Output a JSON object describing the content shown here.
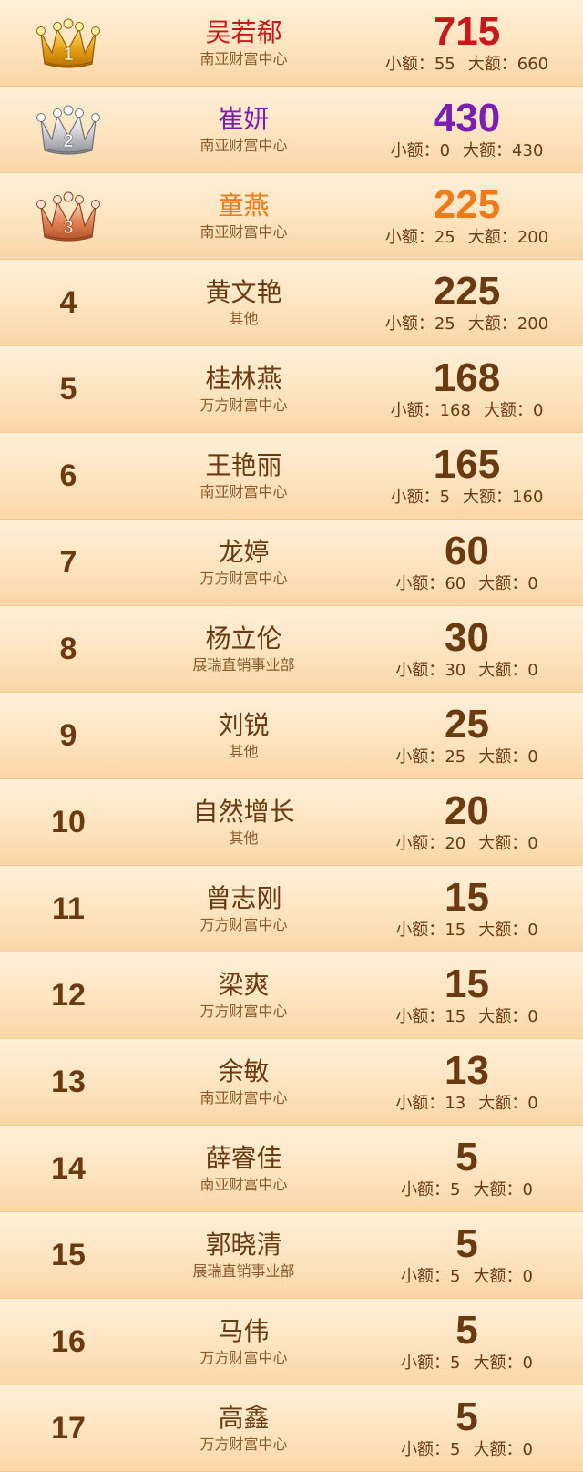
{
  "labels": {
    "small": "小额：",
    "big": "大额："
  },
  "colors": {
    "gold": "#c9181a",
    "silver": "#7a1fb0",
    "bronze": "#ef7a17",
    "default": "#6b3a10"
  },
  "rows": [
    {
      "rank": "1",
      "badge": "gold",
      "name": "吴若郗",
      "dept": "南亚财富中心",
      "total": "715",
      "small": "55",
      "big": "660"
    },
    {
      "rank": "2",
      "badge": "silver",
      "name": "崔妍",
      "dept": "南亚财富中心",
      "total": "430",
      "small": "0",
      "big": "430"
    },
    {
      "rank": "3",
      "badge": "bronze",
      "name": "童燕",
      "dept": "南亚财富中心",
      "total": "225",
      "small": "25",
      "big": "200"
    },
    {
      "rank": "4",
      "badge": "",
      "name": "黄文艳",
      "dept": "其他",
      "total": "225",
      "small": "25",
      "big": "200"
    },
    {
      "rank": "5",
      "badge": "",
      "name": "桂林燕",
      "dept": "万方财富中心",
      "total": "168",
      "small": "168",
      "big": "0"
    },
    {
      "rank": "6",
      "badge": "",
      "name": "王艳丽",
      "dept": "南亚财富中心",
      "total": "165",
      "small": "5",
      "big": "160"
    },
    {
      "rank": "7",
      "badge": "",
      "name": "龙婷",
      "dept": "万方财富中心",
      "total": "60",
      "small": "60",
      "big": "0"
    },
    {
      "rank": "8",
      "badge": "",
      "name": "杨立伦",
      "dept": "展瑞直销事业部",
      "total": "30",
      "small": "30",
      "big": "0"
    },
    {
      "rank": "9",
      "badge": "",
      "name": "刘锐",
      "dept": "其他",
      "total": "25",
      "small": "25",
      "big": "0"
    },
    {
      "rank": "10",
      "badge": "",
      "name": "自然增长",
      "dept": "其他",
      "total": "20",
      "small": "20",
      "big": "0"
    },
    {
      "rank": "11",
      "badge": "",
      "name": "曾志刚",
      "dept": "万方财富中心",
      "total": "15",
      "small": "15",
      "big": "0"
    },
    {
      "rank": "12",
      "badge": "",
      "name": "梁爽",
      "dept": "万方财富中心",
      "total": "15",
      "small": "15",
      "big": "0"
    },
    {
      "rank": "13",
      "badge": "",
      "name": "余敏",
      "dept": "南亚财富中心",
      "total": "13",
      "small": "13",
      "big": "0"
    },
    {
      "rank": "14",
      "badge": "",
      "name": "薛睿佳",
      "dept": "南亚财富中心",
      "total": "5",
      "small": "5",
      "big": "0"
    },
    {
      "rank": "15",
      "badge": "",
      "name": "郭晓清",
      "dept": "展瑞直销事业部",
      "total": "5",
      "small": "5",
      "big": "0"
    },
    {
      "rank": "16",
      "badge": "",
      "name": "马伟",
      "dept": "万方财富中心",
      "total": "5",
      "small": "5",
      "big": "0"
    },
    {
      "rank": "17",
      "badge": "",
      "name": "高鑫",
      "dept": "万方财富中心",
      "total": "5",
      "small": "5",
      "big": "0"
    }
  ]
}
